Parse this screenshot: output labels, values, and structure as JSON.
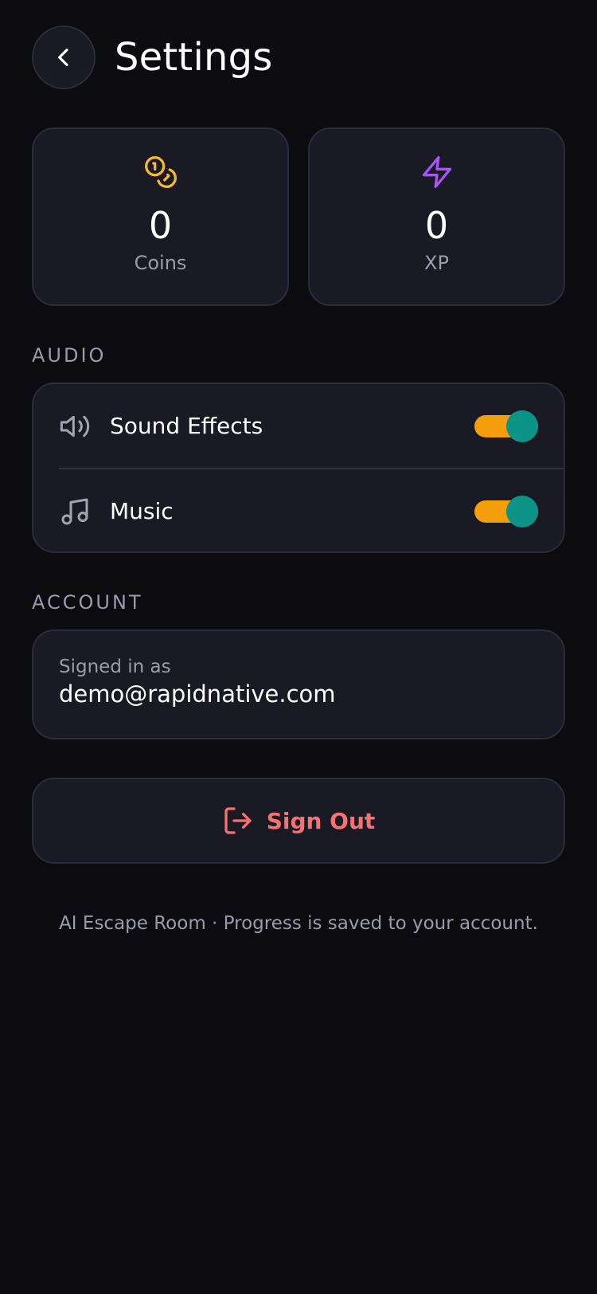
{
  "header": {
    "title": "Settings",
    "back_icon": "chevron-left-icon"
  },
  "stats": [
    {
      "label": "Coins",
      "value": "0",
      "icon": "coins-icon",
      "color": "#f5b82e"
    },
    {
      "label": "XP",
      "value": "0",
      "icon": "lightning-icon",
      "color": "#a855f7"
    }
  ],
  "audio": {
    "section_label": "AUDIO",
    "items": [
      {
        "label": "Sound Effects",
        "icon": "speaker-icon",
        "enabled": true
      },
      {
        "label": "Music",
        "icon": "music-note-icon",
        "enabled": true
      }
    ]
  },
  "account": {
    "section_label": "ACCOUNT",
    "caption": "Signed in as",
    "email": "demo@rapidnative.com"
  },
  "signout": {
    "label": "Sign Out",
    "icon": "logout-icon",
    "color": "#f87171"
  },
  "footer": {
    "note": "AI Escape Room · Progress is saved to your account."
  },
  "colors": {
    "background": "#0b0b10",
    "card": "#1a1a24",
    "toggle_track_on": "#f59e0b",
    "toggle_thumb": "#0d9488"
  }
}
